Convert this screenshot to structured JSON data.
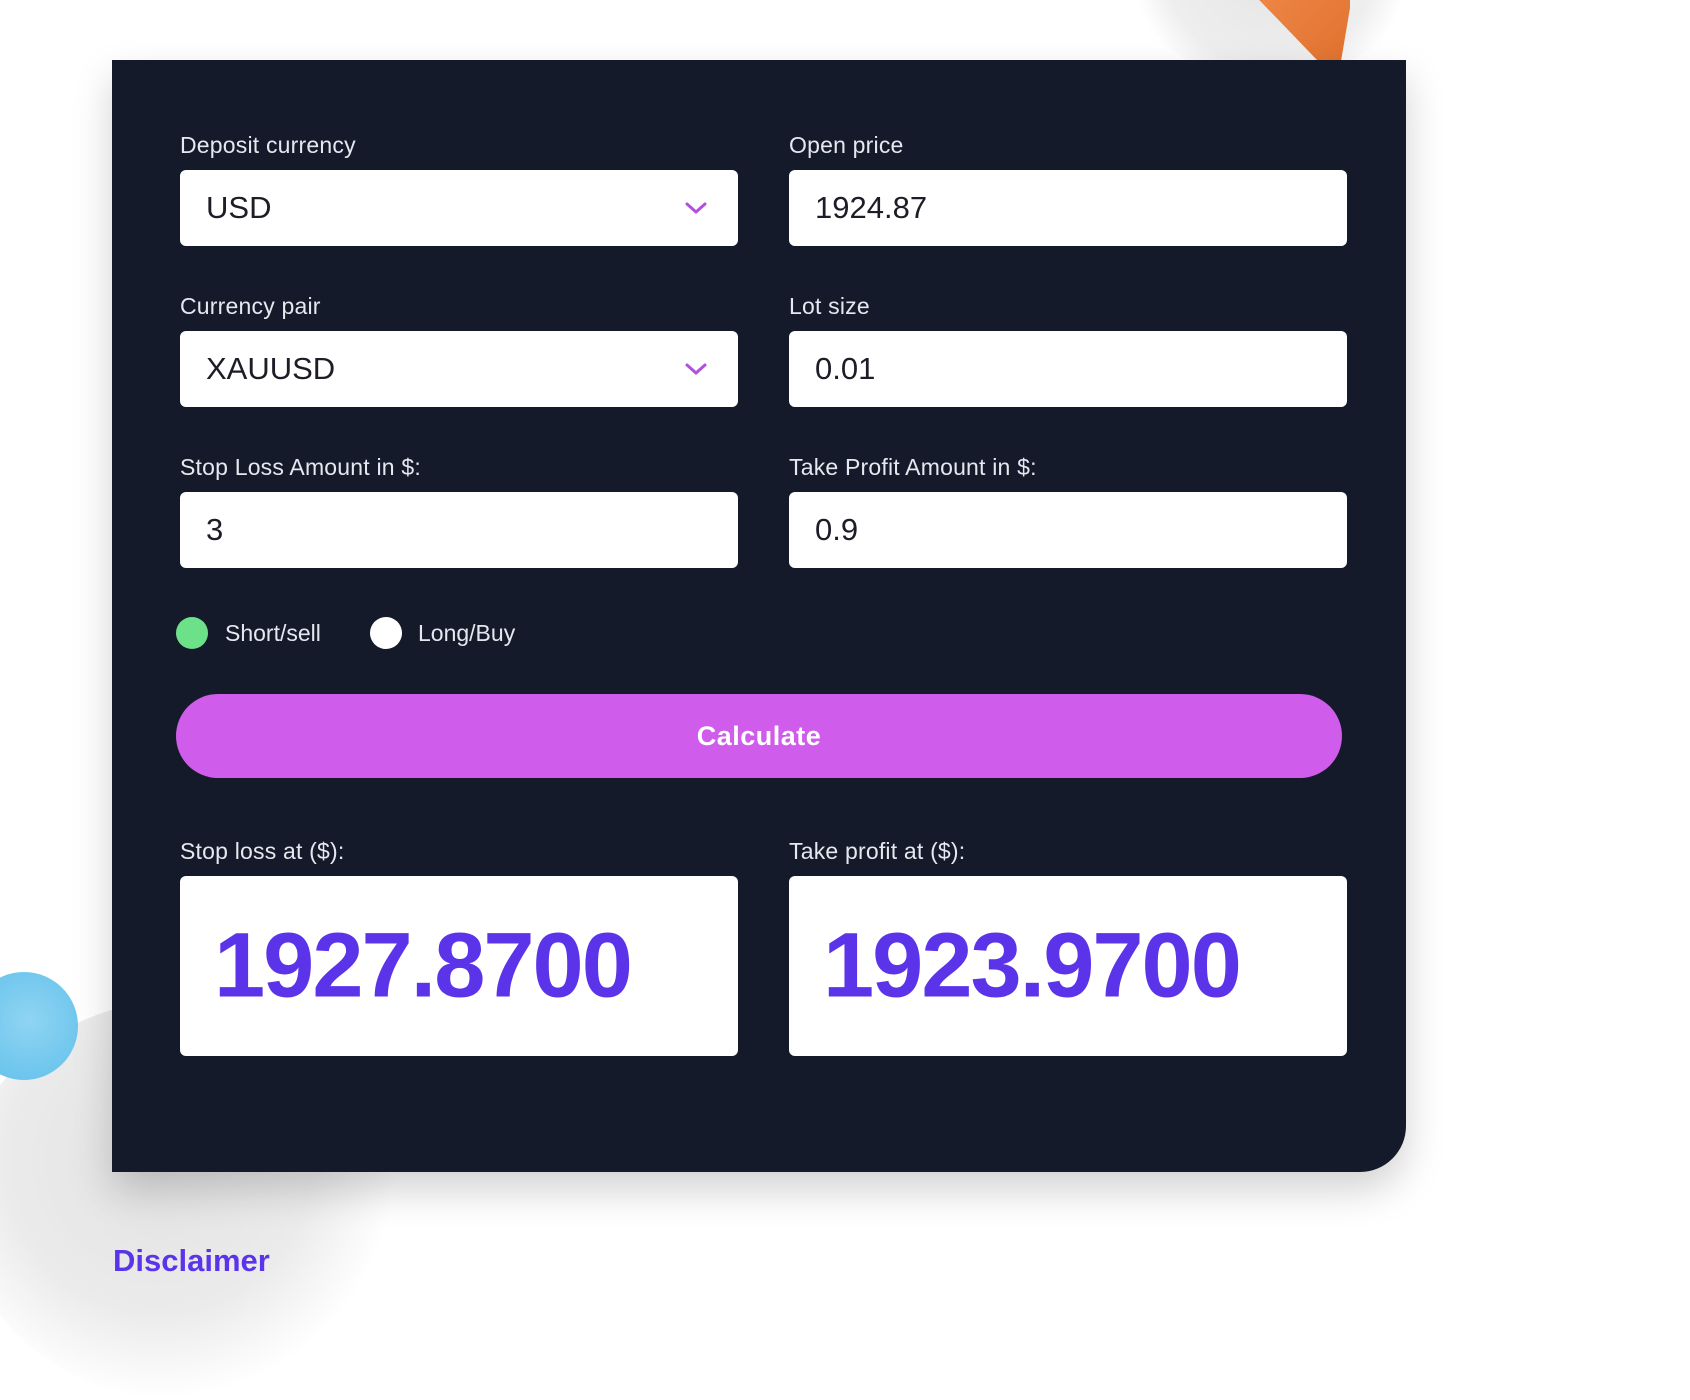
{
  "form": {
    "deposit_currency": {
      "label": "Deposit currency",
      "value": "USD"
    },
    "open_price": {
      "label": "Open price",
      "value": "1924.87"
    },
    "currency_pair": {
      "label": "Currency pair",
      "value": "XAUUSD"
    },
    "lot_size": {
      "label": "Lot size",
      "value": "0.01"
    },
    "stop_loss_amount": {
      "label": "Stop Loss Amount in $:",
      "value": "3"
    },
    "take_profit_amount": {
      "label": "Take Profit Amount in $:",
      "value": "0.9"
    },
    "direction": {
      "options": [
        {
          "label": "Short/sell",
          "selected": true
        },
        {
          "label": "Long/Buy",
          "selected": false
        }
      ]
    },
    "calculate_label": "Calculate"
  },
  "results": {
    "stop_loss": {
      "label": "Stop loss at ($):",
      "value": "1927.8700"
    },
    "take_profit": {
      "label": "Take profit at ($):",
      "value": "1923.9700"
    }
  },
  "footer": {
    "disclaimer_label": "Disclaimer"
  },
  "colors": {
    "card_bg": "#141a2a",
    "accent_button": "#cf5ceb",
    "result_text": "#5b34ea",
    "chevron": "#b24fe0",
    "radio_selected": "#6de08a",
    "radio_unselected": "#ffffff"
  },
  "icons": {
    "dropdown": "chevron-down-icon"
  }
}
